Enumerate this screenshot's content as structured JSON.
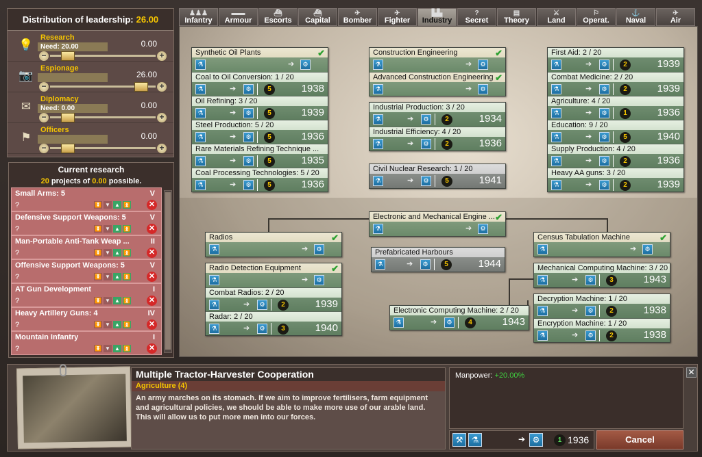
{
  "leadership": {
    "title": "Distribution of leadership:",
    "total": "26.00",
    "rows": [
      {
        "name": "Research",
        "need": "Need: 20.00",
        "value": "0.00",
        "slider": 0.12,
        "icon": "lightbulb-icon"
      },
      {
        "name": "Espionage",
        "need": "",
        "value": "26.00",
        "slider": 0.92,
        "icon": "camera-icon"
      },
      {
        "name": "Diplomacy",
        "need": "Need: 0.00",
        "value": "0.00",
        "slider": 0.12,
        "icon": "envelope-icon"
      },
      {
        "name": "Officers",
        "need": "",
        "value": "0.00",
        "slider": 0.12,
        "icon": "flag-icon"
      }
    ]
  },
  "current_research": {
    "title": "Current research",
    "count": "20",
    "mid": "projects of",
    "possible": "0.00",
    "tail": "possible.",
    "items": [
      {
        "name": "Small Arms: 5",
        "rank": "V",
        "q": "?"
      },
      {
        "name": "Defensive Support Weapons: 5",
        "rank": "V",
        "q": "?"
      },
      {
        "name": "Man-Portable Anti-Tank Weap ...",
        "rank": "II",
        "q": "?"
      },
      {
        "name": "Offensive Support Weapons: 5",
        "rank": "V",
        "q": "?"
      },
      {
        "name": "AT Gun Development",
        "rank": "I",
        "q": "?"
      },
      {
        "name": "Heavy Artillery Guns: 4",
        "rank": "IV",
        "q": "?"
      },
      {
        "name": "Mountain Infantry",
        "rank": "I",
        "q": "?"
      }
    ]
  },
  "tabs": [
    "Infantry",
    "Armour",
    "Escorts",
    "Capital",
    "Bomber",
    "Fighter",
    "Industry",
    "Secret",
    "Theory",
    "Land",
    "Operat.",
    "Naval",
    "Air"
  ],
  "active_tab": "Industry",
  "tree": {
    "col1": [
      {
        "name": "Synthetic Oil Plants",
        "done": true
      },
      {
        "name": "Coal to Oil Conversion: 1 / 20",
        "num": "5",
        "year": "1938"
      },
      {
        "name": "Oil Refining: 3 / 20",
        "num": "5",
        "year": "1939"
      },
      {
        "name": "Steel Production: 5 / 20",
        "num": "5",
        "year": "1936"
      },
      {
        "name": "Rare Materials Refining Technique ...",
        "num": "5",
        "year": "1935"
      },
      {
        "name": "Coal Processing Technologies: 5 / 20",
        "num": "5",
        "year": "1936"
      }
    ],
    "col2a": [
      {
        "name": "Construction Engineering",
        "done": true
      },
      {
        "name": "Advanced Construction Engineering",
        "done": true
      }
    ],
    "col2b": [
      {
        "name": "Industrial Production: 3 / 20",
        "num": "2",
        "year": "1934"
      },
      {
        "name": "Industrial Efficiency: 4 / 20",
        "num": "2",
        "year": "1936"
      }
    ],
    "nuclear": {
      "name": "Civil Nuclear Research: 1 / 20",
      "num": "5",
      "year": "1941"
    },
    "col3": [
      {
        "name": "First Aid: 2 / 20",
        "num": "2",
        "year": "1939"
      },
      {
        "name": "Combat Medicine: 2 / 20",
        "num": "2",
        "year": "1939"
      },
      {
        "name": "Agriculture: 4 / 20",
        "num": "1",
        "year": "1936"
      },
      {
        "name": "Education: 9 / 20",
        "num": "5",
        "year": "1940"
      },
      {
        "name": "Supply Production: 4 / 20",
        "num": "2",
        "year": "1936"
      },
      {
        "name": "Heavy AA guns: 3 / 20",
        "num": "2",
        "year": "1939"
      }
    ],
    "emech": {
      "name": "Electronic and Mechanical Engine ...",
      "done": true
    },
    "radio": [
      {
        "name": "Radios",
        "done": true
      }
    ],
    "radar": [
      {
        "name": "Radio Detection Equipment",
        "done": true
      },
      {
        "name": "Combat Radios: 2 / 20",
        "num": "2",
        "year": "1939"
      },
      {
        "name": "Radar: 2 / 20",
        "num": "3",
        "year": "1940"
      }
    ],
    "harbour": {
      "name": "Prefabricated Harbours",
      "num": "5",
      "year": "1944"
    },
    "ecomp": {
      "name": "Electronic Computing Machine: 2 / 20",
      "num": "4",
      "year": "1943"
    },
    "census": {
      "name": "Census Tabulation Machine",
      "done": true
    },
    "mcomp": {
      "name": "Mechanical Computing Machine: 3 / 20",
      "num": "3",
      "year": "1943"
    },
    "crypto": [
      {
        "name": "Decryption Machine: 1 / 20",
        "num": "2",
        "year": "1938"
      },
      {
        "name": "Encryption Machine: 1 / 20",
        "num": "2",
        "year": "1938"
      }
    ]
  },
  "detail": {
    "title": "Multiple Tractor-Harvester Cooperation",
    "category": "Agriculture (4)",
    "description": "An army marches on its stomach. If we aim to improve fertilisers, farm equipment and agricultural policies, we should be able to make more use of our arable land. This will allow us to put more men into our forces.",
    "effect_label": "Manpower:",
    "effect_value": "+20.00%",
    "num": "1",
    "year": "1936",
    "cancel": "Cancel"
  }
}
